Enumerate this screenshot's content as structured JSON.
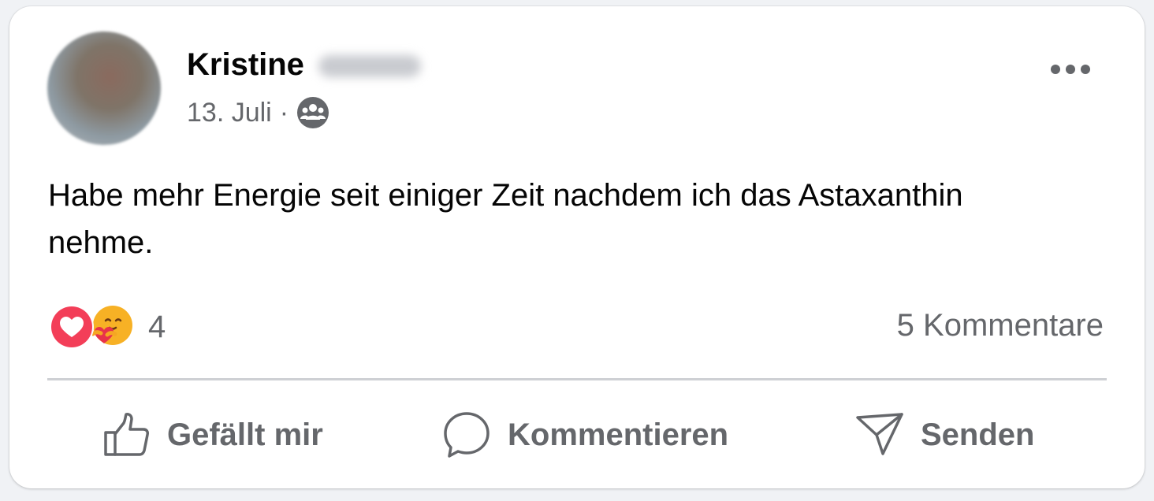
{
  "post": {
    "author_first_name": "Kristine",
    "date": "13. Juli",
    "separator": "·",
    "audience_icon": "group-icon",
    "text": "Habe mehr Energie seit einiger Zeit nachdem ich das Astaxanthin nehme.",
    "reaction_icons": [
      "love-reaction-icon",
      "care-reaction-icon"
    ],
    "reaction_count": "4",
    "comments_label": "5 Kommentare"
  },
  "actions": {
    "like_label": "Gefällt mir",
    "comment_label": "Kommentieren",
    "send_label": "Senden"
  },
  "colors": {
    "text_primary": "#050505",
    "text_secondary": "#65676b",
    "love_red": "#f33e58",
    "care_yellow": "#f7b125",
    "divider": "#ced0d4"
  }
}
